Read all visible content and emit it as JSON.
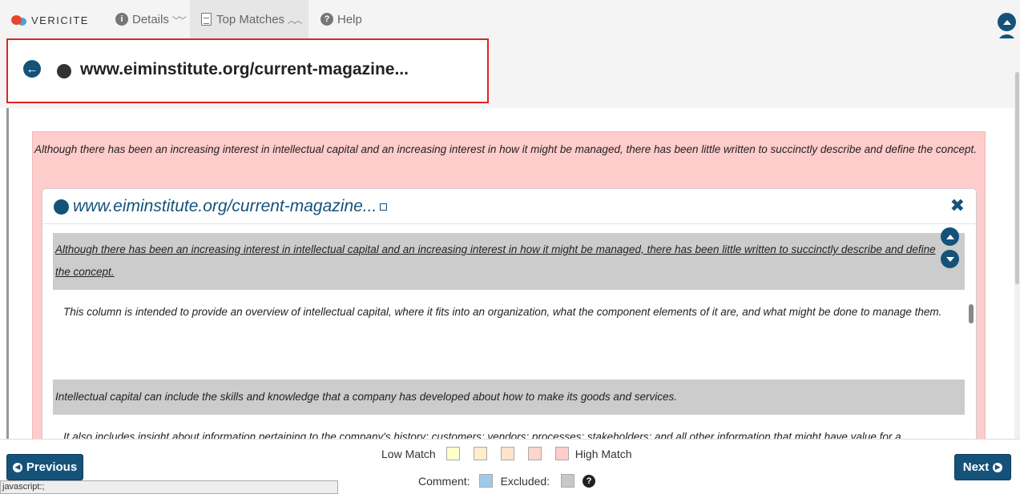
{
  "app": {
    "logo_text": "VERICITE"
  },
  "tabs": [
    {
      "label": "Details",
      "icon": "info-icon",
      "chevron": "chevron-double-down-icon"
    },
    {
      "label": "Top Matches",
      "icon": "document-icon",
      "chevron": "chevron-double-up-icon"
    },
    {
      "label": "Help",
      "icon": "question-icon"
    }
  ],
  "source": {
    "title": "www.eiminstitute.org/current-magazine..."
  },
  "passage": {
    "text": "Although there has been an increasing interest in intellectual capital and an increasing interest in how it might be managed, there has been little written to succinctly describe and define the concept."
  },
  "match_panel": {
    "title": "www.eiminstitute.org/current-magazine...",
    "close_label": "✖",
    "paragraphs": [
      {
        "text": "Although there has been an increasing interest in intellectual capital and an increasing interest in how it might be managed, there has been little written to succinctly describe and define the concept.",
        "highlighted": true,
        "underlined": true
      },
      {
        "text": "This column is intended to provide an overview of intellectual capital, where it fits into an organization, what the component elements of it are, and what might be done to manage them.",
        "highlighted": false
      },
      {
        "text": "Intellectual capital can include the skills and knowledge that a company has developed about how to make its goods and services.",
        "highlighted": true
      },
      {
        "text": "It also includes insight about information pertaining to the company's history; customers; vendors; processes; stakeholders; and all other information that might have value for a",
        "highlighted": false
      }
    ]
  },
  "footer": {
    "previous_label": "Previous",
    "next_label": "Next",
    "low_match_label": "Low Match",
    "high_match_label": "High Match",
    "comment_label": "Comment:",
    "excluded_label": "Excluded:",
    "status_text": "javascript:;"
  },
  "colors": {
    "accent": "#15527a",
    "match_high": "#ffcccc",
    "highlight_gray": "#cccccc",
    "legend": [
      "#ffffcc",
      "#ffedcc",
      "#ffe4cc",
      "#ffd6cc",
      "#ffcccc"
    ],
    "comment": "#9fcbe8",
    "excluded": "#c8c8c8"
  }
}
